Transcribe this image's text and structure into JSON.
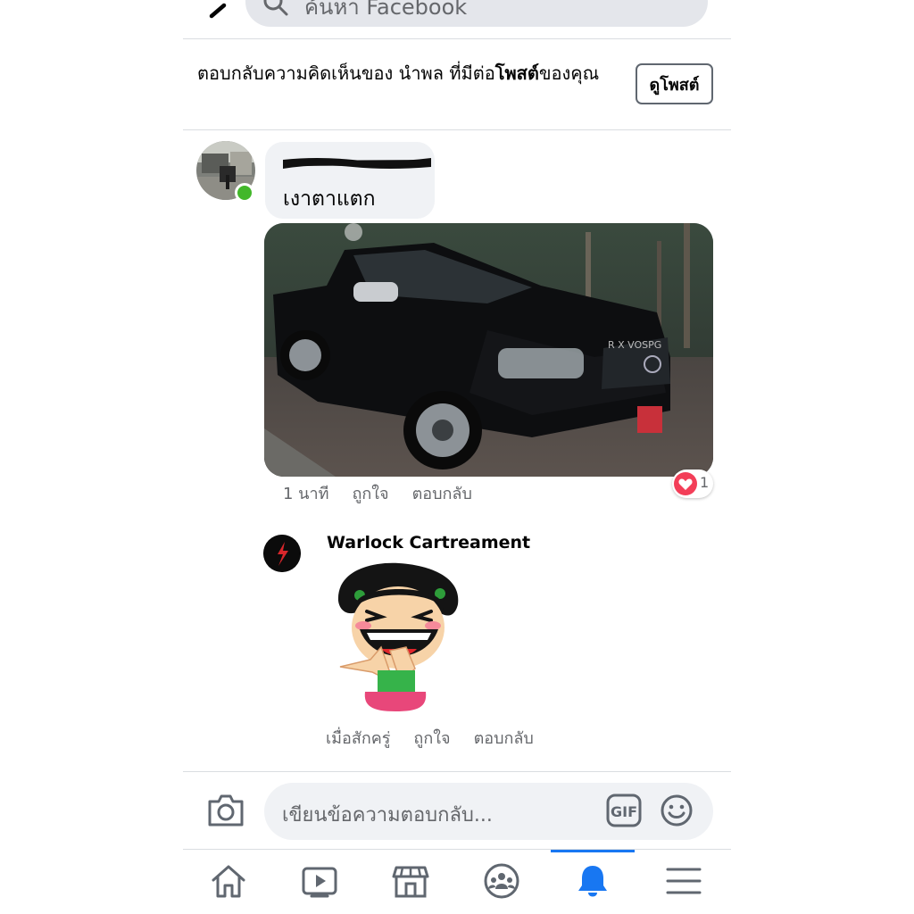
{
  "search": {
    "placeholder": "ค้นหา Facebook"
  },
  "context": {
    "prefix": "ตอบกลับความคิดเห็นของ นำพล ที่มีต่อ",
    "bold": "โพสต์",
    "suffix": "ของคุณ",
    "view_post_label": "ดูโพสต์"
  },
  "comment1": {
    "text": "เงาตาแตก",
    "time": "1 นาที",
    "like_label": "ถูกใจ",
    "reply_label": "ตอบกลับ",
    "reaction_count": "1",
    "reaction_icon": "heart-icon"
  },
  "comment2": {
    "author": "Warlock Cartreament",
    "time": "เมื่อสักครู่",
    "like_label": "ถูกใจ",
    "reply_label": "ตอบกลับ"
  },
  "composer": {
    "placeholder": "เขียนข้อความตอบกลับ..."
  },
  "nav": {
    "items": [
      "home-icon",
      "watch-icon",
      "marketplace-icon",
      "groups-icon",
      "notifications-icon",
      "menu-icon"
    ],
    "active": "notifications-icon"
  },
  "colors": {
    "accent": "#1877f2",
    "online": "#42b72a",
    "heart": "#f33e58",
    "bubble": "#f0f2f5"
  }
}
